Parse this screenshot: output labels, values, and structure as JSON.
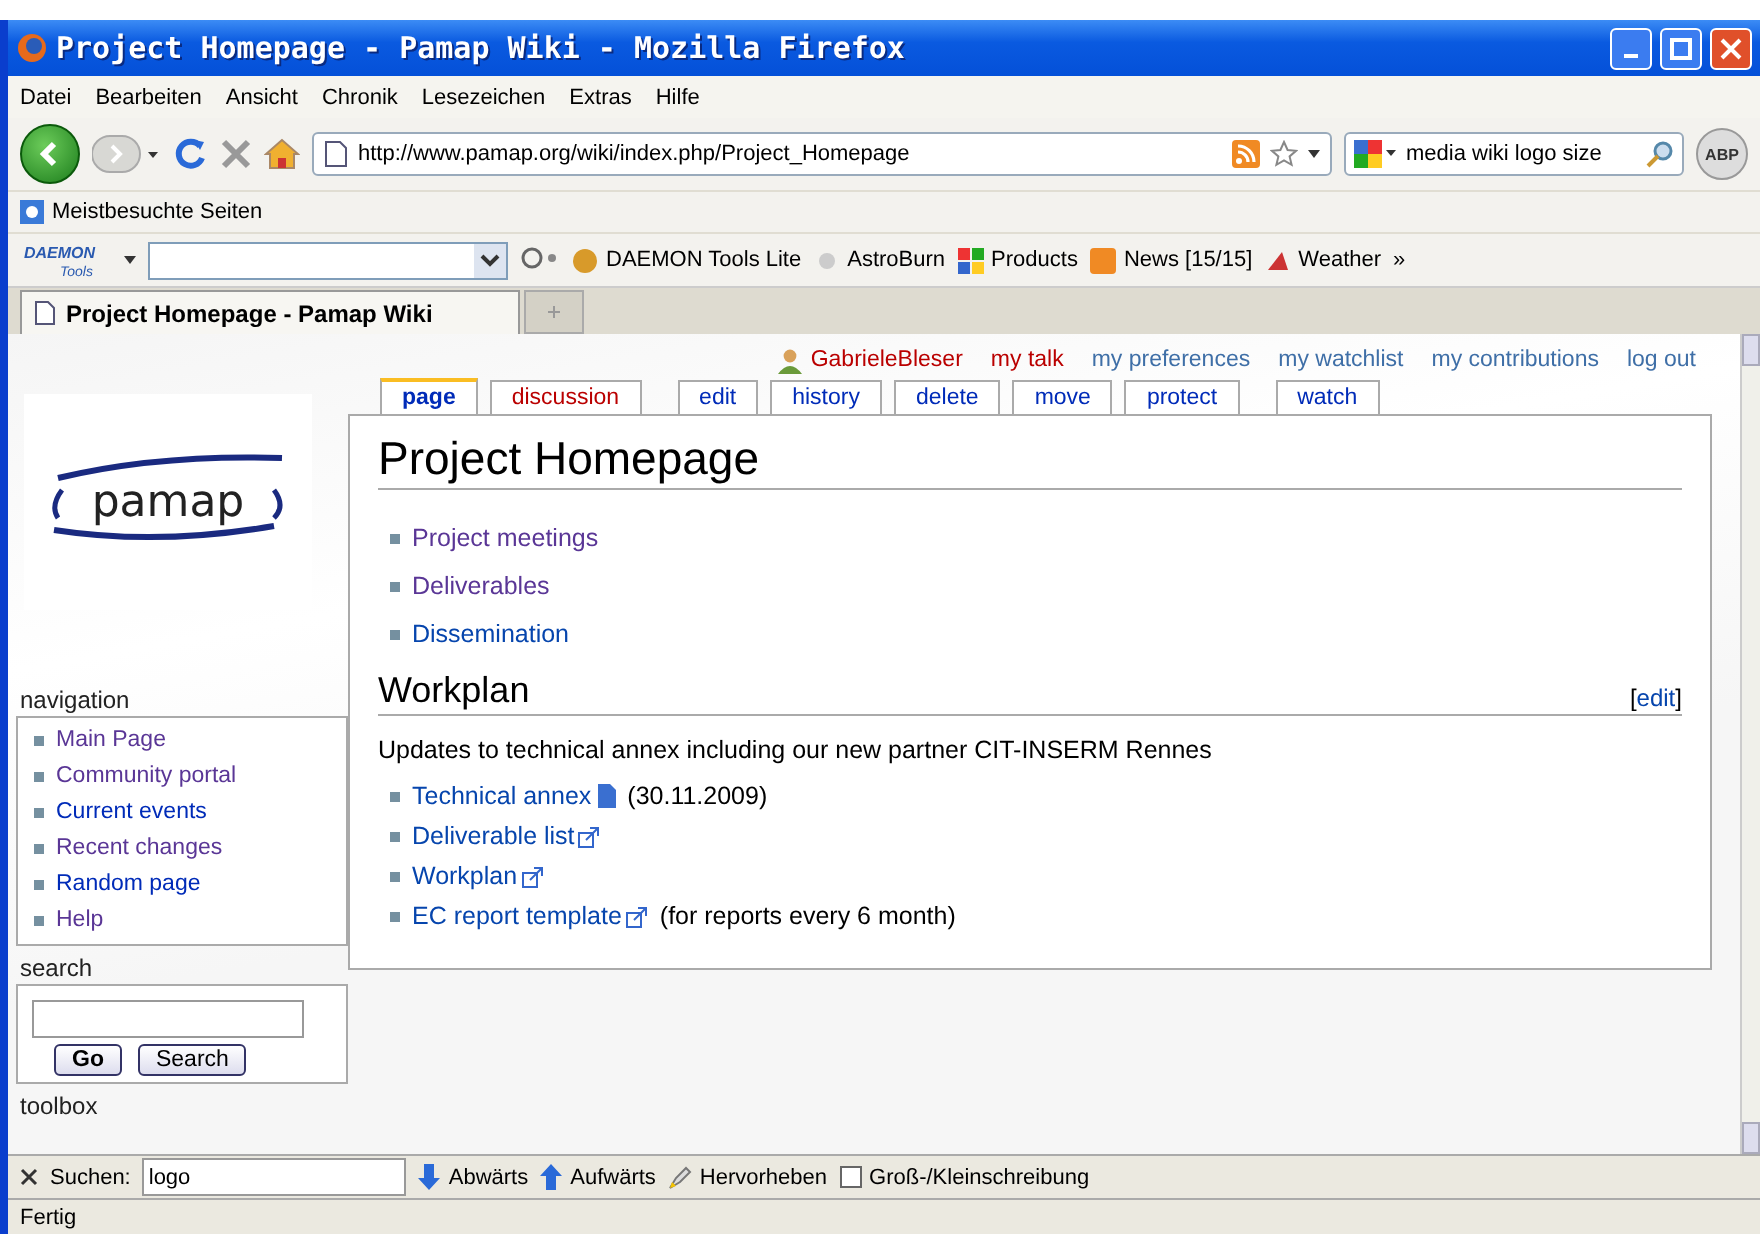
{
  "window": {
    "title": "Project Homepage - Pamap Wiki - Mozilla Firefox"
  },
  "menu": [
    "Datei",
    "Bearbeiten",
    "Ansicht",
    "Chronik",
    "Lesezeichen",
    "Extras",
    "Hilfe"
  ],
  "navigation_bar": {
    "url": "http://www.pamap.org/wiki/index.php/Project_Homepage",
    "search_value": "media wiki logo size",
    "adblock": "ABP"
  },
  "bookmarks": [
    "Meistbesuchte Seiten"
  ],
  "daemon_toolbar": {
    "logo_top": "DAEMON",
    "logo_bottom": "Tools",
    "items": [
      "DAEMON Tools Lite",
      "AstroBurn",
      "Products",
      "News [15/15]",
      "Weather"
    ],
    "more": "»"
  },
  "browser_tabs": [
    {
      "label": "Project Homepage - Pamap Wiki",
      "selected": true
    }
  ],
  "personal": [
    {
      "label": "GabrieleBleser",
      "missing": true,
      "kind": "user"
    },
    {
      "label": "my talk",
      "missing": true,
      "kind": "link"
    },
    {
      "label": "my preferences",
      "missing": false,
      "kind": "link"
    },
    {
      "label": "my watchlist",
      "missing": false,
      "kind": "link"
    },
    {
      "label": "my contributions",
      "missing": false,
      "kind": "link"
    },
    {
      "label": "log out",
      "missing": false,
      "kind": "link"
    }
  ],
  "page_tabs": [
    {
      "label": "page",
      "selected": true,
      "missing": false
    },
    {
      "label": "discussion",
      "selected": false,
      "missing": true
    },
    {
      "label": "edit",
      "selected": false,
      "missing": false
    },
    {
      "label": "history",
      "selected": false,
      "missing": false
    },
    {
      "label": "delete",
      "selected": false,
      "missing": false
    },
    {
      "label": "move",
      "selected": false,
      "missing": false
    },
    {
      "label": "protect",
      "selected": false,
      "missing": false
    },
    {
      "label": "watch",
      "selected": false,
      "missing": false
    }
  ],
  "logo": {
    "text": "pamap"
  },
  "sidebar": {
    "navigation": {
      "title": "navigation",
      "items": [
        {
          "label": "Main Page",
          "visited": true
        },
        {
          "label": "Community portal",
          "visited": true
        },
        {
          "label": "Current events",
          "visited": false
        },
        {
          "label": "Recent changes",
          "visited": true
        },
        {
          "label": "Random page",
          "visited": false
        },
        {
          "label": "Help",
          "visited": true
        }
      ]
    },
    "search": {
      "title": "search",
      "buttons": [
        "Go",
        "Search"
      ]
    },
    "toolbox": {
      "title": "toolbox"
    }
  },
  "article": {
    "title": "Project Homepage",
    "links": [
      {
        "label": "Project meetings",
        "visited": true
      },
      {
        "label": "Deliverables",
        "visited": true
      },
      {
        "label": "Dissemination",
        "visited": false
      }
    ],
    "section": {
      "title": "Workplan",
      "edit_open": "[",
      "edit": "edit",
      "edit_close": "]",
      "intro": "Updates to technical annex including our new partner CIT-INSERM Rennes",
      "items": [
        {
          "label": "Technical annex",
          "kind": "file",
          "note": "(30.11.2009)"
        },
        {
          "label": "Deliverable list",
          "kind": "external"
        },
        {
          "label": "Workplan",
          "kind": "external"
        },
        {
          "label": "EC report template",
          "kind": "external",
          "note": "(for reports every 6 month)"
        }
      ]
    }
  },
  "find_bar": {
    "label": "Suchen:",
    "value": "logo",
    "down": "Abwärts",
    "up": "Aufwärts",
    "highlight": "Hervorheben",
    "match_case": {
      "label": "Groß-/Kleinschreibung",
      "checked": false
    }
  },
  "status_bar": {
    "text": "Fertig"
  }
}
